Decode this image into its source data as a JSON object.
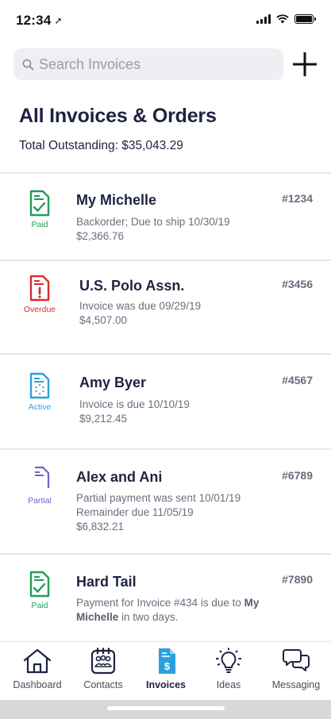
{
  "status_bar": {
    "time": "12:34",
    "location_arrow": "➚"
  },
  "search": {
    "placeholder": "Search Invoices"
  },
  "header": {
    "title": "All Invoices & Orders",
    "outstanding": "Total Outstanding:  $35,043.29"
  },
  "colors": {
    "paid": "#1f9d57",
    "overdue": "#d92c2c",
    "active": "#2aa0e0",
    "partial": "#7b5ccf",
    "title": "#1e2342"
  },
  "invoices": [
    {
      "status": "Paid",
      "status_icon": "document-check-icon",
      "name": "My Michelle",
      "number": "#1234",
      "line1": "Backorder;  Due to ship 10/30/19",
      "line2": "$2,366.76"
    },
    {
      "status": "Overdue",
      "status_icon": "document-alert-icon",
      "name": "U.S. Polo Assn.",
      "number": "#3456",
      "line1": "Invoice was due 09/29/19",
      "line2": "$4,507.00"
    },
    {
      "status": "Active",
      "status_icon": "document-pending-icon",
      "name": "Amy Byer",
      "number": "#4567",
      "line1": "Invoice is due 10/10/19",
      "line2": "$9,212.45"
    },
    {
      "status": "Partial",
      "status_icon": "document-partial-icon",
      "name": "Alex and Ani",
      "number": "#6789",
      "line1": "Partial payment was sent 10/01/19",
      "line2": "Remainder due 11/05/19",
      "line3": "$6,832.21"
    },
    {
      "status": "Paid",
      "status_icon": "document-check-icon",
      "name": "Hard Tail",
      "number": "#7890",
      "line1_pre": "Payment for Invoice #434 is due to ",
      "line1_bold": "My",
      "line2_bold": "Michelle",
      "line2_post": " in two days."
    }
  ],
  "tabs": [
    {
      "label": "Dashboard",
      "icon": "home-icon",
      "active": false
    },
    {
      "label": "Contacts",
      "icon": "contacts-icon",
      "active": false
    },
    {
      "label": "Invoices",
      "icon": "invoice-icon",
      "active": true
    },
    {
      "label": "Ideas",
      "icon": "lightbulb-icon",
      "active": false
    },
    {
      "label": "Messaging",
      "icon": "chat-icon",
      "active": false
    }
  ]
}
